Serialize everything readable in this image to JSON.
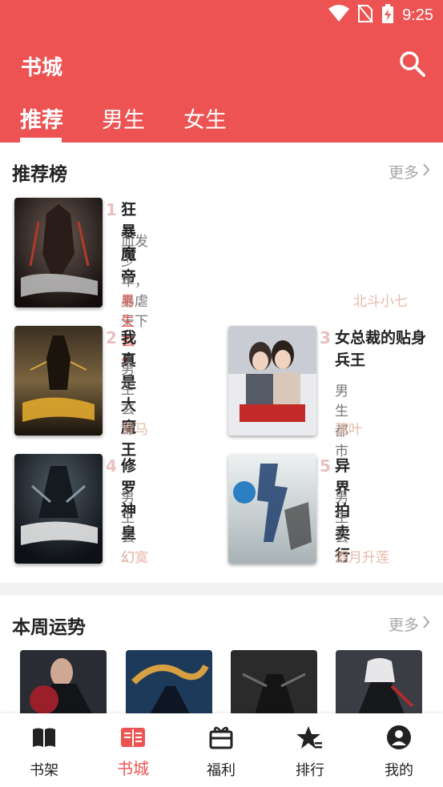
{
  "status_bar": {
    "time": "9:25"
  },
  "app_bar": {
    "title": "书城"
  },
  "tabs": [
    {
      "label": "推荐",
      "active": true
    },
    {
      "label": "男生",
      "active": false
    },
    {
      "label": "女生",
      "active": false
    }
  ],
  "recommend": {
    "title": "推荐榜",
    "more": "更多",
    "books": [
      {
        "rank": "1",
        "title": "狂暴魔帝",
        "desc": "血发少年，暴虐天下",
        "genre": "男生玄幻",
        "author": "北斗小七"
      },
      {
        "rank": "2",
        "title": "我真是大魔王",
        "genre": "男生玄幻",
        "author": "青马"
      },
      {
        "rank": "3",
        "title": "女总裁的贴身兵王",
        "genre": "男生都市",
        "author": "落叶"
      },
      {
        "rank": "4",
        "title": "修罗神皇",
        "genre": "男生玄幻",
        "author": "幻寞"
      },
      {
        "rank": "5",
        "title": "异界拍卖行",
        "genre": "男生玄幻",
        "author": "逐月升莲"
      }
    ]
  },
  "weekly": {
    "title": "本周运势",
    "more": "更多"
  },
  "bottom_nav": [
    {
      "label": "书架",
      "icon": "bookshelf-icon",
      "active": false
    },
    {
      "label": "书城",
      "icon": "bookstore-icon",
      "active": true
    },
    {
      "label": "福利",
      "icon": "gift-icon",
      "active": false
    },
    {
      "label": "排行",
      "icon": "ranking-star-icon",
      "active": false
    },
    {
      "label": "我的",
      "icon": "profile-icon",
      "active": false
    }
  ],
  "colors": {
    "brand": "#ec5352",
    "rank_number": "#e8c0c0",
    "author": "#e8b9a8",
    "muted": "#777777"
  }
}
